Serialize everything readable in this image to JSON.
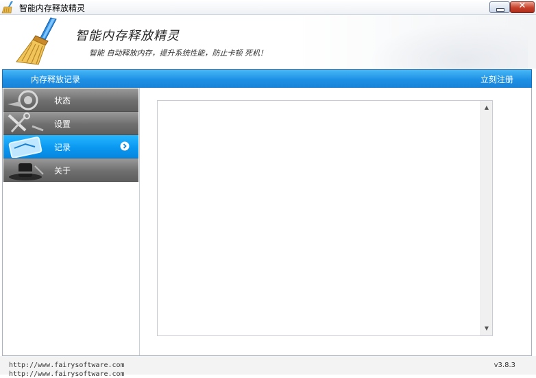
{
  "window": {
    "title": "智能内存释放精灵",
    "minimize_icon": "minimize-icon",
    "close_label": "✕"
  },
  "header": {
    "app_name": "智能内存释放精灵",
    "slogan": "智能 自动释放内存，提升系统性能，防止卡顿 死机！",
    "logo_icon": "broom-icon"
  },
  "bluebar": {
    "title": "内存释放记录",
    "register_label": "立刻注册"
  },
  "sidebar": {
    "items": [
      {
        "label": "状态",
        "icon": "status-icon",
        "active": false
      },
      {
        "label": "设置",
        "icon": "tools-icon",
        "active": false
      },
      {
        "label": "记录",
        "icon": "record-icon",
        "active": true
      },
      {
        "label": "关于",
        "icon": "about-icon",
        "active": false
      }
    ]
  },
  "content": {
    "scroll_up": "▲",
    "scroll_down": "▼"
  },
  "footer": {
    "url": "http://www.fairysoftware.com",
    "url2": "http://www.fairysoftware.com",
    "version": "v3.8.3"
  },
  "colors": {
    "accent_blue": "#1e90e4",
    "nav_gray": "#6f6f6f",
    "nav_active": "#0a98f1"
  }
}
